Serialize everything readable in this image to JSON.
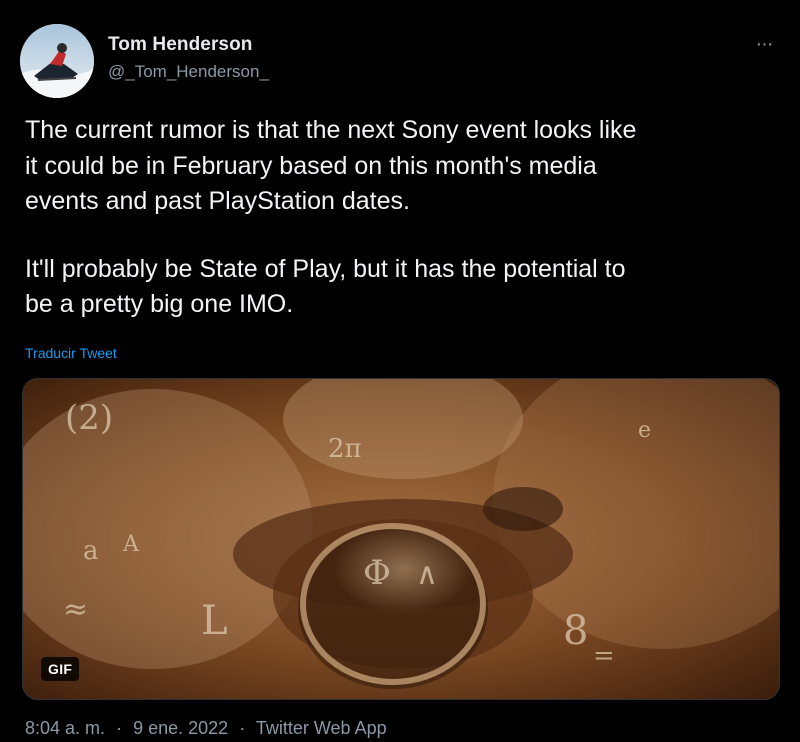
{
  "author": {
    "name": "Tom Henderson",
    "handle": "@_Tom_Henderson_"
  },
  "more_label": "···",
  "tweet": {
    "paragraphs": [
      "The current rumor is that the next Sony event looks like\nit could be in February based on this month's media\nevents and past PlayStation dates.",
      "It'll probably be State of Play, but it has the potential to\nbe a pretty big one IMO."
    ],
    "translate_label": "Traducir Tweet"
  },
  "media": {
    "badge": "GIF"
  },
  "meta": {
    "time": "8:04 a. m.",
    "sep": "·",
    "date": "9 ene. 2022",
    "source": "Twitter Web App"
  },
  "colors": {
    "background": "#000000",
    "text": "#e7e9ea",
    "secondary": "#8b98a5",
    "link": "#1d9bf0"
  }
}
